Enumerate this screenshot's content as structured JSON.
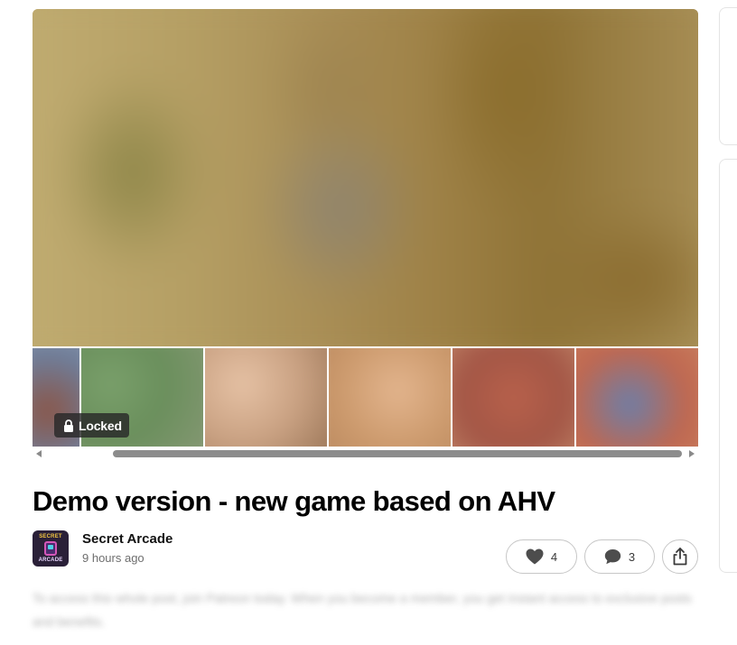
{
  "post": {
    "locked_label": "Locked",
    "title": "Demo version - new game based on AHV",
    "creator": {
      "name": "Secret Arcade",
      "timestamp": "9 hours ago",
      "avatar_text_top": "SECRET",
      "avatar_text_bottom": "ARCADE"
    },
    "actions": {
      "likes": "4",
      "comments": "3"
    },
    "blurred_teaser": "To access this whole post, join Patreon today. When you become a member, you get instant access to exclusive posts and benefits."
  },
  "gallery": {
    "thumbnail_count": 6
  },
  "icons": {
    "lock": "lock-icon",
    "heart": "heart-icon",
    "comment": "comment-icon",
    "share": "share-icon"
  },
  "colors": {
    "text": "#121212",
    "muted": "#6e6e6e",
    "border": "#c7c7c7",
    "locked_badge_bg": "#282828"
  }
}
